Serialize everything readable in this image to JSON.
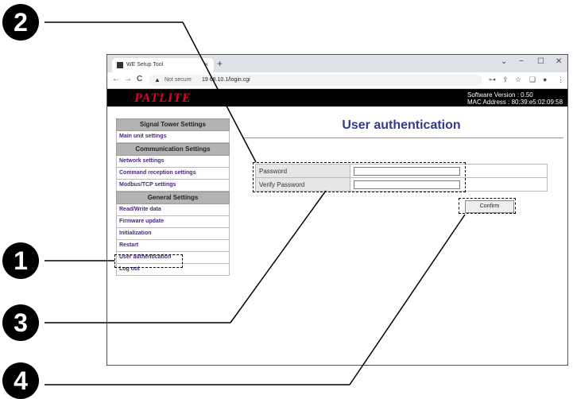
{
  "browser": {
    "tab_title": "WE Setup Tool",
    "tab_close": "×",
    "new_tab": "+",
    "window_controls": {
      "chevron": "⌄",
      "minimize": "−",
      "maximize": "☐",
      "close": "✕"
    },
    "nav": {
      "back": "←",
      "forward": "→",
      "reload": "C"
    },
    "security_label": "Not secure",
    "url": "19 68.10.1/login.cgi",
    "toolbar_icons": {
      "key": "⊶",
      "share": "⇪",
      "star": "☆",
      "split": "❏",
      "profile": "●",
      "menu": "⋮"
    }
  },
  "header": {
    "logo": "PATLITE",
    "software_version": "Software Version : 0.50",
    "mac_address": "MAC Address : 80:39:e5:02:09:58"
  },
  "sidebar": {
    "categories": [
      "Signal Tower Settings",
      "Communication Settings",
      "General Settings"
    ],
    "items": [
      "Main unit settings",
      "Network settings",
      "Command reception settings",
      "Modbus/TCP settings",
      "Read/Write data",
      "Firmware update",
      "Initialization",
      "Restart",
      "User authentication",
      "Log out"
    ]
  },
  "main": {
    "title": "User authentication",
    "password_label": "Password",
    "verify_label": "Verify Password",
    "confirm_label": "Confirm"
  },
  "callouts": [
    "1",
    "2",
    "3",
    "4"
  ]
}
